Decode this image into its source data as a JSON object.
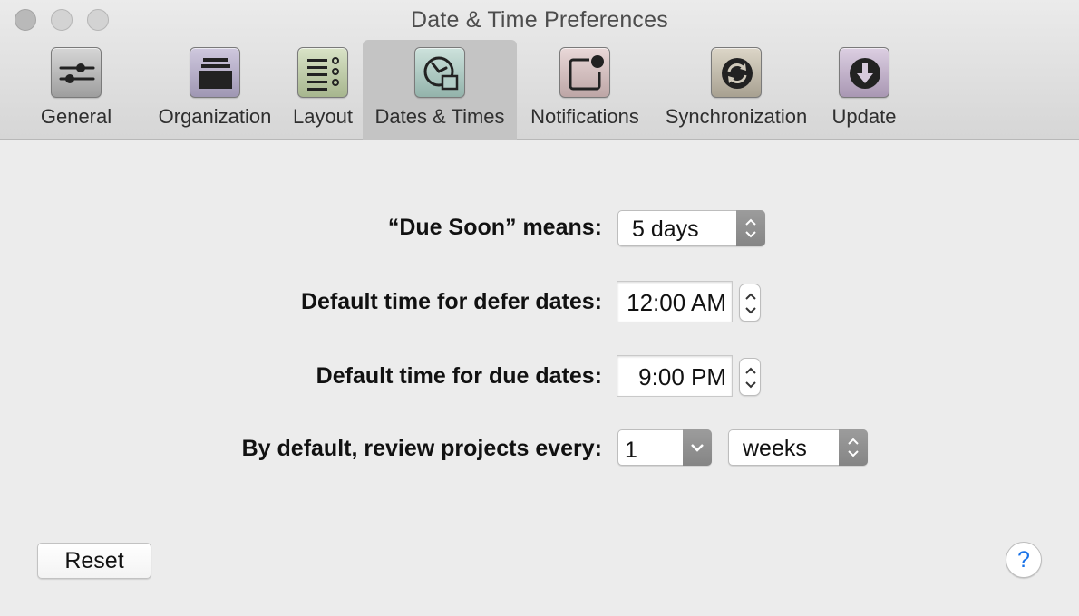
{
  "window": {
    "title": "Date & Time Preferences"
  },
  "toolbar": {
    "tabs": [
      {
        "label": "General",
        "icon": "sliders-icon"
      },
      {
        "label": "Organization",
        "icon": "inbox-tray-icon"
      },
      {
        "label": "Layout",
        "icon": "list-layout-icon"
      },
      {
        "label": "Dates & Times",
        "icon": "clock-calendar-icon",
        "selected": true
      },
      {
        "label": "Notifications",
        "icon": "notification-badge-icon"
      },
      {
        "label": "Synchronization",
        "icon": "sync-arrows-icon"
      },
      {
        "label": "Update",
        "icon": "download-arrow-icon"
      }
    ]
  },
  "settings": {
    "due_soon": {
      "label": "“Due Soon” means:",
      "value": "5 days"
    },
    "defer_time": {
      "label": "Default time for defer dates:",
      "value": "12:00 AM"
    },
    "due_time": {
      "label": "Default time for due dates:",
      "value": "9:00 PM"
    },
    "review": {
      "label": "By default, review projects every:",
      "count": "1",
      "unit": "weeks"
    }
  },
  "footer": {
    "reset_label": "Reset",
    "help_label": "?"
  },
  "colors": {
    "window_bg": "#ececec",
    "selected_tab_bg": "#c4c4c4",
    "help_accent": "#1a73e8"
  }
}
